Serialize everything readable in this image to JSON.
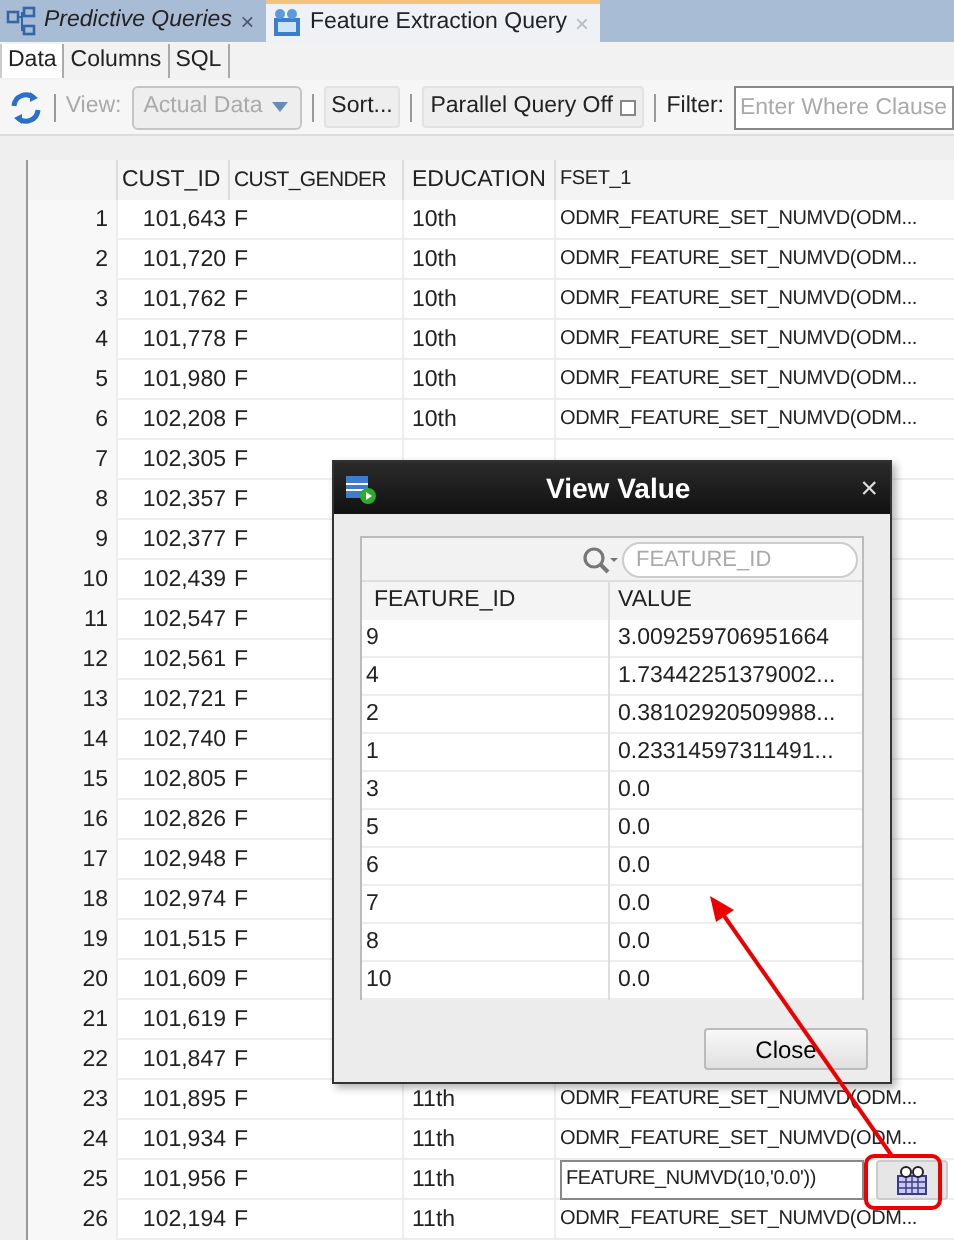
{
  "editor_tabs": [
    {
      "label": "Predictive Queries",
      "selected": false,
      "close": "×"
    },
    {
      "label": "Feature Extraction Query",
      "selected": true,
      "close": "×"
    }
  ],
  "sub_tabs": [
    {
      "label": "Data",
      "selected": true
    },
    {
      "label": "Columns",
      "selected": false
    },
    {
      "label": "SQL",
      "selected": false
    }
  ],
  "toolbar": {
    "view_label": "View:",
    "view_value": "Actual Data",
    "view_disabled": true,
    "sort": "Sort...",
    "parallel": "Parallel Query Off",
    "filter_label": "Filter:",
    "filter_placeholder": "Enter Where Clause"
  },
  "table": {
    "columns": [
      "CUST_ID",
      "CUST_GENDER",
      "EDUCATION",
      "FSET_1"
    ],
    "rows": [
      {
        "n": "1",
        "cust_id": "101,643",
        "gender": "F",
        "education": "10th",
        "fset_1": "ODMR_FEATURE_SET_NUMVD(ODM...",
        "editing": false
      },
      {
        "n": "2",
        "cust_id": "101,720",
        "gender": "F",
        "education": "10th",
        "fset_1": "ODMR_FEATURE_SET_NUMVD(ODM...",
        "editing": false
      },
      {
        "n": "3",
        "cust_id": "101,762",
        "gender": "F",
        "education": "10th",
        "fset_1": "ODMR_FEATURE_SET_NUMVD(ODM...",
        "editing": false
      },
      {
        "n": "4",
        "cust_id": "101,778",
        "gender": "F",
        "education": "10th",
        "fset_1": "ODMR_FEATURE_SET_NUMVD(ODM...",
        "editing": false
      },
      {
        "n": "5",
        "cust_id": "101,980",
        "gender": "F",
        "education": "10th",
        "fset_1": "ODMR_FEATURE_SET_NUMVD(ODM...",
        "editing": false
      },
      {
        "n": "6",
        "cust_id": "102,208",
        "gender": "F",
        "education": "10th",
        "fset_1": "ODMR_FEATURE_SET_NUMVD(ODM...",
        "editing": false
      },
      {
        "n": "7",
        "cust_id": "102,305",
        "gender": "F",
        "editing": false
      },
      {
        "n": "8",
        "cust_id": "102,357",
        "gender": "F",
        "editing": false
      },
      {
        "n": "9",
        "cust_id": "102,377",
        "gender": "F",
        "editing": false
      },
      {
        "n": "10",
        "cust_id": "102,439",
        "gender": "F",
        "editing": false
      },
      {
        "n": "11",
        "cust_id": "102,547",
        "gender": "F",
        "editing": false
      },
      {
        "n": "12",
        "cust_id": "102,561",
        "gender": "F",
        "editing": false
      },
      {
        "n": "13",
        "cust_id": "102,721",
        "gender": "F",
        "editing": false
      },
      {
        "n": "14",
        "cust_id": "102,740",
        "gender": "F",
        "editing": false
      },
      {
        "n": "15",
        "cust_id": "102,805",
        "gender": "F",
        "editing": false
      },
      {
        "n": "16",
        "cust_id": "102,826",
        "gender": "F",
        "editing": false
      },
      {
        "n": "17",
        "cust_id": "102,948",
        "gender": "F",
        "editing": false
      },
      {
        "n": "18",
        "cust_id": "102,974",
        "gender": "F",
        "editing": false
      },
      {
        "n": "19",
        "cust_id": "101,515",
        "gender": "F",
        "editing": false
      },
      {
        "n": "20",
        "cust_id": "101,609",
        "gender": "F",
        "editing": false
      },
      {
        "n": "21",
        "cust_id": "101,619",
        "gender": "F",
        "editing": false
      },
      {
        "n": "22",
        "cust_id": "101,847",
        "gender": "F",
        "editing": false
      },
      {
        "n": "23",
        "cust_id": "101,895",
        "gender": "F",
        "education": "11th",
        "fset_1": "ODMR_FEATURE_SET_NUMVD(ODM...",
        "editing": false
      },
      {
        "n": "24",
        "cust_id": "101,934",
        "gender": "F",
        "education": "11th",
        "fset_1": "ODMR_FEATURE_SET_NUMVD(ODM...",
        "editing": false
      },
      {
        "n": "25",
        "cust_id": "101,956",
        "gender": "F",
        "education": "11th",
        "fset_1": "FEATURE_NUMVD(10,'0.0'))",
        "editing": true
      },
      {
        "n": "26",
        "cust_id": "102,194",
        "gender": "F",
        "education": "11th",
        "fset_1": "ODMR_FEATURE_SET_NUMVD(ODM...",
        "editing": false
      }
    ]
  },
  "dialog": {
    "title": "View Value",
    "close": "×",
    "search_placeholder": "FEATURE_ID",
    "columns": [
      "FEATURE_ID",
      "VALUE"
    ],
    "rows": [
      [
        "9",
        "3.009259706951664"
      ],
      [
        "4",
        "1.73442251379002..."
      ],
      [
        "2",
        "0.38102920509988..."
      ],
      [
        "1",
        "0.23314597311491..."
      ],
      [
        "3",
        "0.0"
      ],
      [
        "5",
        "0.0"
      ],
      [
        "6",
        "0.0"
      ],
      [
        "7",
        "0.0"
      ],
      [
        "8",
        "0.0"
      ],
      [
        "10",
        "0.0"
      ]
    ],
    "button": "Close"
  }
}
